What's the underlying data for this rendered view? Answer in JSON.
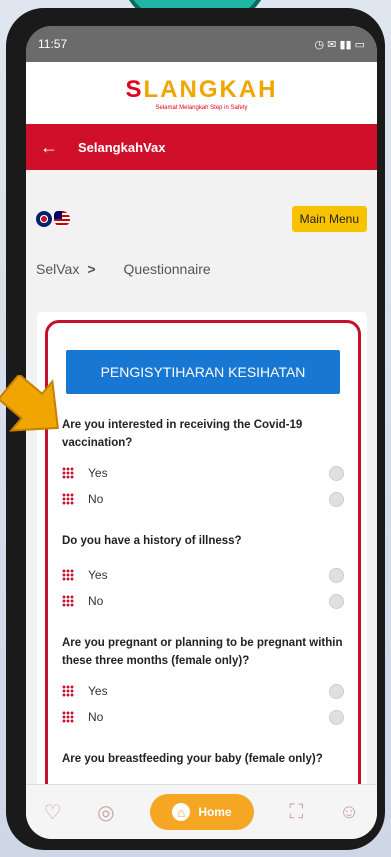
{
  "status": {
    "time": "11:57"
  },
  "logo": {
    "main_s": "S",
    "main_rest": "LANGKAH",
    "tagline": "Selamat Melangkah Step in Safety"
  },
  "appbar": {
    "title": "SelangkahVax"
  },
  "menu": {
    "main_menu": "Main Menu"
  },
  "breadcrumb": {
    "root": "SelVax",
    "current": "Questionnaire"
  },
  "form": {
    "header": "PENGISYTIHARAN KESIHATAN",
    "questions": [
      {
        "text": "Are you interested in receiving the Covid-19 vaccination?",
        "options": [
          "Yes",
          "No"
        ]
      },
      {
        "text": "Do you have a history of illness?",
        "options": [
          "Yes",
          "No"
        ]
      },
      {
        "text": "Are you pregnant or planning to be pregnant within these three months (female only)?",
        "options": [
          "Yes",
          "No"
        ]
      },
      {
        "text": "Are you breastfeeding your baby (female only)?",
        "options": []
      }
    ]
  },
  "bottom_nav": {
    "home": "Home"
  },
  "colors": {
    "accent": "#d0102a",
    "primary_button": "#1877d2",
    "home_pill": "#f5a623",
    "main_menu_bg": "#f7c200"
  },
  "icons": [
    "back-arrow-icon",
    "uk-flag-icon",
    "malaysia-flag-icon",
    "heart-monitor-icon",
    "globe-icon",
    "home-icon",
    "scan-icon",
    "people-icon",
    "pointer-arrow-icon"
  ]
}
